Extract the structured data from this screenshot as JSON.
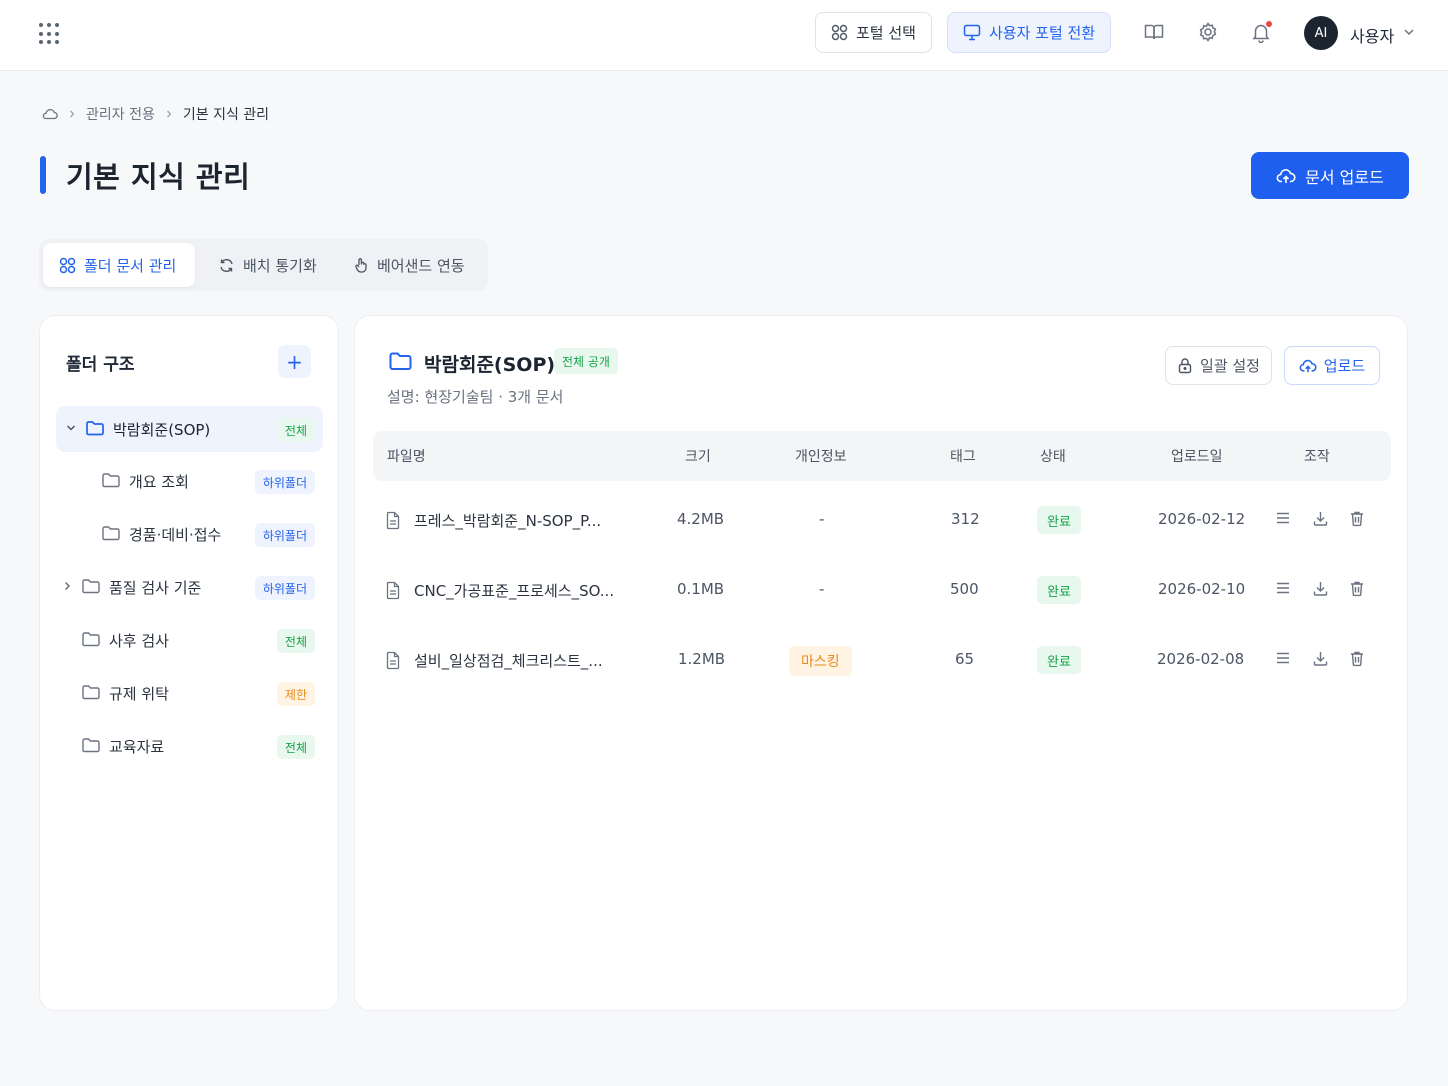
{
  "topbar": {
    "portal_select": "포털 선택",
    "user_portal_switch": "사용자 포털 전환",
    "avatar_initials": "AI",
    "user_name": "사용자"
  },
  "breadcrumb": {
    "level1": "관리자 전용",
    "level2": "기본 지식 관리"
  },
  "page": {
    "title": "기본 지식 관리",
    "upload_button": "문서 업로드"
  },
  "tabs": [
    "폴더 문서 관리",
    "배치 통기화",
    "베어샌드 연동"
  ],
  "sidebar": {
    "title": "폴더 구조",
    "add_label": "+",
    "folders": [
      {
        "name": "박람회준(SOP)",
        "badge": "전체"
      },
      {
        "name": "개요 조회",
        "badge": "하위폴더"
      },
      {
        "name": "경품·데비·접수",
        "badge": "하위폴더"
      },
      {
        "name": "품질 검사 기준",
        "badge": "하위폴더"
      },
      {
        "name": "사후 검사",
        "badge": "전체"
      },
      {
        "name": "규제 위탁",
        "badge": "제한"
      },
      {
        "name": "교육자료",
        "badge": "전체"
      }
    ]
  },
  "main": {
    "folder_title": "박람회준(SOP)",
    "visibility_badge": "전체 공개",
    "description": "설명: 현장기술팀 · 3개 문서",
    "bulk_settings": "일괄 설정",
    "upload": "업로드",
    "columns": [
      "파일명",
      "크기",
      "개인정보",
      "태그",
      "상태",
      "업로드일",
      "조작"
    ],
    "rows": [
      {
        "file": "프레스_박람회준_N-SOP_P...",
        "size": "4.2MB",
        "privacy": "-",
        "tags": "312",
        "status": "완료",
        "date": "2026-02-12"
      },
      {
        "file": "CNC_가공표준_프로세스_SO...",
        "size": "0.1MB",
        "privacy": "-",
        "tags": "500",
        "status": "완료",
        "date": "2026-02-10"
      },
      {
        "file": "설비_일상점검_체크리스트_...",
        "size": "1.2MB",
        "privacy": "마스킹",
        "tags": "65",
        "status": "완료",
        "date": "2026-02-08"
      }
    ]
  },
  "colors": {
    "accent": "#1f5fef",
    "success": "#16a34a",
    "warning": "#ea8a1a",
    "alert": "#ef4444"
  }
}
